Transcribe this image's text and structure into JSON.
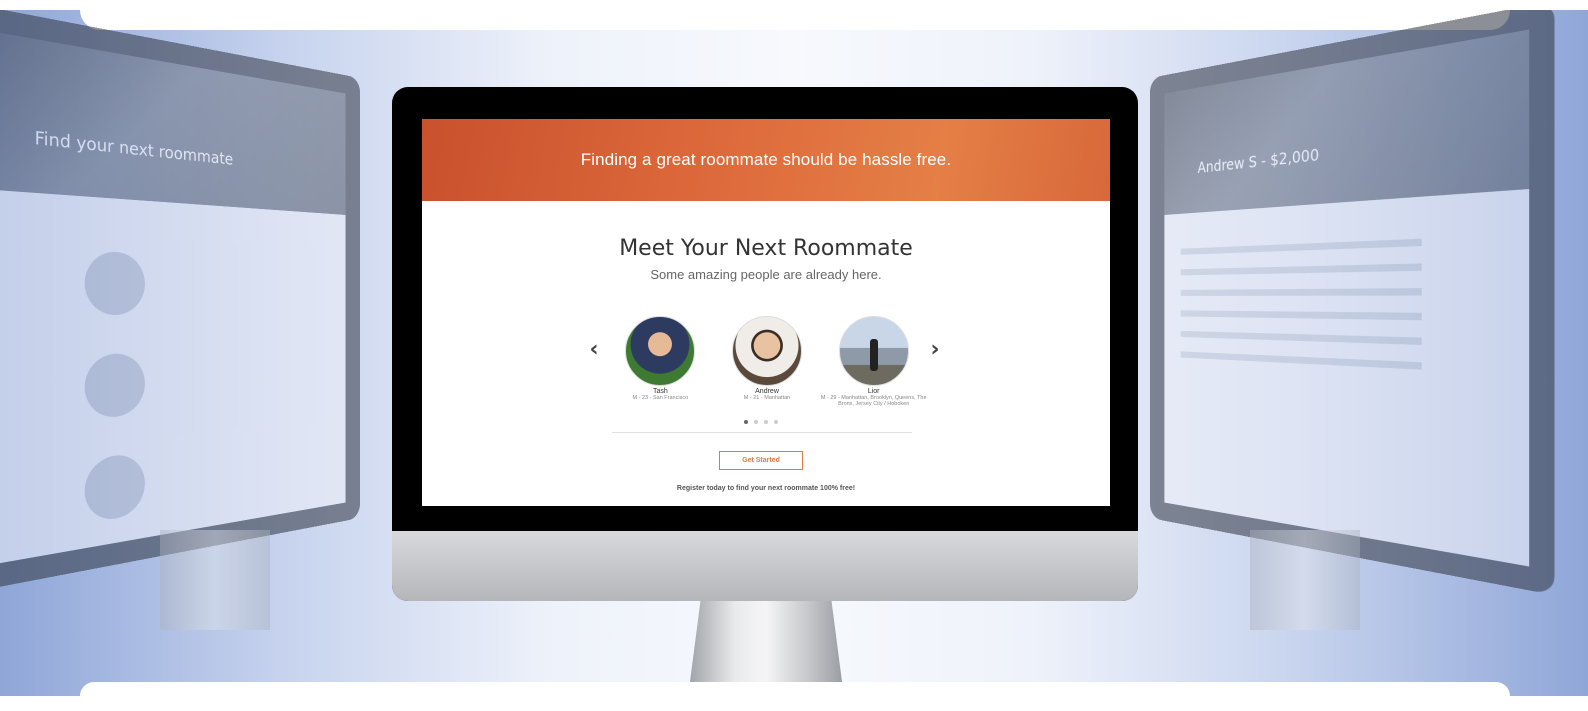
{
  "hero": {
    "tagline": "Finding a great roommate should be hassle free."
  },
  "section": {
    "title": "Meet Your Next Roommate",
    "subtitle": "Some amazing people are already here."
  },
  "carousel": {
    "prev_icon": "chevron-left-icon",
    "next_icon": "chevron-right-icon",
    "prev_glyph": "‹",
    "next_glyph": "›",
    "people": [
      {
        "name": "Tash",
        "info": "M - 23 - San Francisco"
      },
      {
        "name": "Andrew",
        "info": "M - 21 - Manhattan"
      },
      {
        "name": "Lior",
        "info": "M - 29 - Manhattan, Brooklyn, Queens, The Bronx, Jersey City / Hoboken"
      }
    ],
    "page_count": 4,
    "active_page": 1
  },
  "cta": {
    "label": "Get Started"
  },
  "footer": {
    "register_text": "Register today to find your next roommate 100% free!"
  },
  "side_left": {
    "hero_text": "Find your next roommate"
  },
  "side_right": {
    "hero_text": "Andrew S - $2,000"
  },
  "colors": {
    "accent": "#e07a45",
    "hero": "#d9643a",
    "band": "#c7d3ee"
  }
}
